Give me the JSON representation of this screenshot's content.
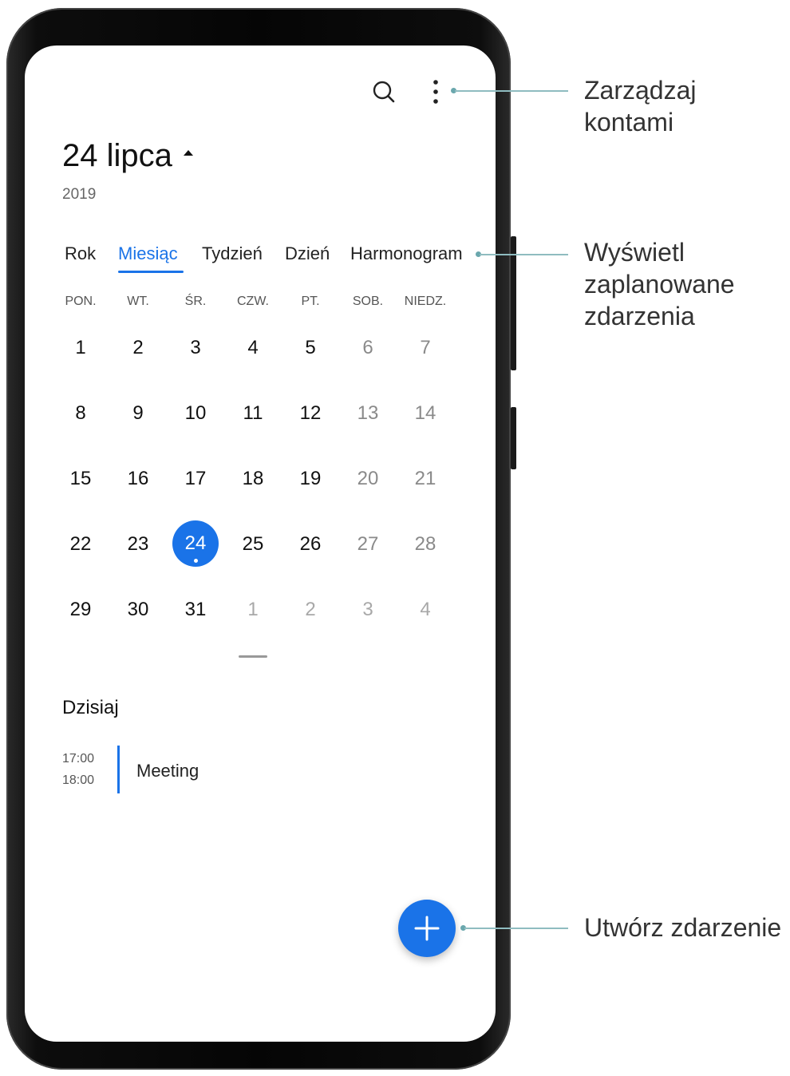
{
  "header": {
    "title": "24 lipca",
    "year": "2019"
  },
  "tabs": [
    {
      "label": "Rok"
    },
    {
      "label": "Miesiąc"
    },
    {
      "label": "Tydzień"
    },
    {
      "label": "Dzień"
    },
    {
      "label": "Harmonogram"
    }
  ],
  "weekdays": [
    "PON.",
    "WT.",
    "ŚR.",
    "CZW.",
    "PT.",
    "SOB.",
    "NIEDZ."
  ],
  "weeks": [
    [
      "1",
      "2",
      "3",
      "4",
      "5",
      "6",
      "7"
    ],
    [
      "8",
      "9",
      "10",
      "11",
      "12",
      "13",
      "14"
    ],
    [
      "15",
      "16",
      "17",
      "18",
      "19",
      "20",
      "21"
    ],
    [
      "22",
      "23",
      "24",
      "25",
      "26",
      "27",
      "28"
    ],
    [
      "29",
      "30",
      "31",
      "1",
      "2",
      "3",
      "4"
    ]
  ],
  "today_section": {
    "title": "Dzisiaj",
    "event": {
      "start": "17:00",
      "end": "18:00",
      "title": "Meeting"
    }
  },
  "callouts": {
    "manage_accounts_line1": "Zarządzaj",
    "manage_accounts_line2": "kontami",
    "view_events_line1": "Wyświetl",
    "view_events_line2": "zaplanowane",
    "view_events_line3": "zdarzenia",
    "create_event": "Utwórz zdarzenie"
  },
  "colors": {
    "accent": "#1a73e8",
    "callout_line": "#8fbcc0"
  },
  "icons": {
    "search": "search-icon",
    "more": "more-vertical-icon",
    "add": "plus-icon",
    "title_caret": "caret-up-icon"
  }
}
